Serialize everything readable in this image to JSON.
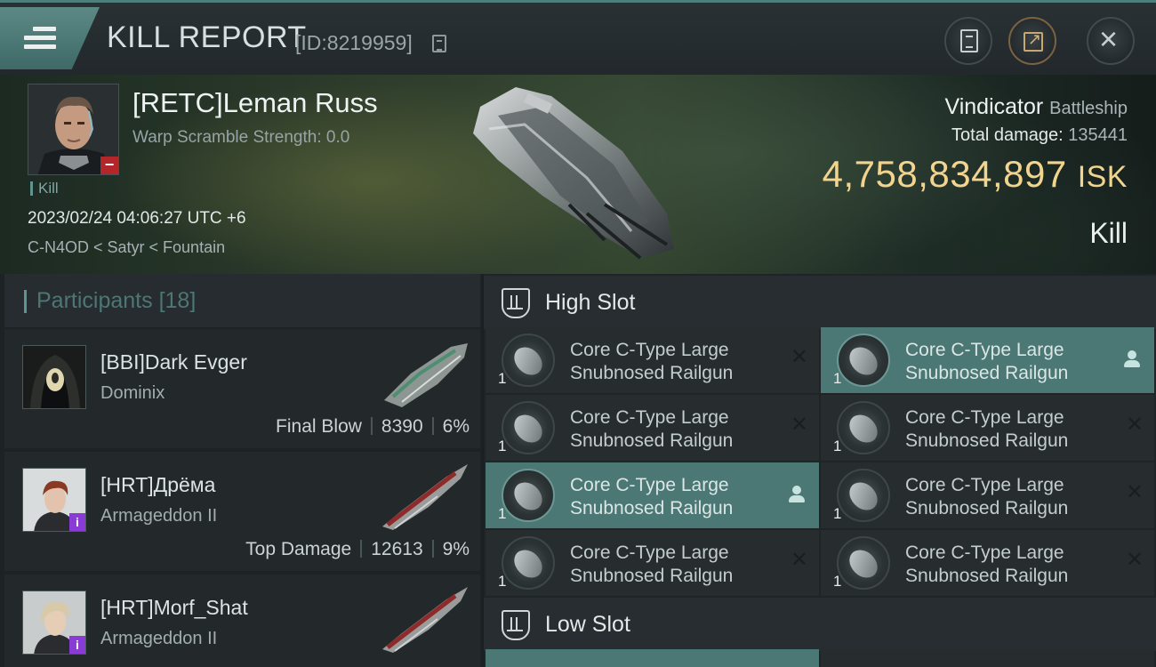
{
  "header": {
    "title": "KILL REPORT",
    "report_id": "[ID:8219959]"
  },
  "victim": {
    "name": "[RETC]Leman Russ",
    "warp_scramble": "Warp Scramble Strength: 0.0",
    "kill_tag": "Kill",
    "datetime": "2023/02/24 04:06:27 UTC +6",
    "location": "C-N4OD < Satyr < Fountain",
    "ship": "Vindicator",
    "ship_class": "Battleship",
    "total_damage_label": "Total damage:",
    "total_damage": "135441",
    "isk_value": "4,758,834,897",
    "isk_unit": "ISK",
    "kind": "Kill"
  },
  "participants": {
    "title": "Participants",
    "count": "[18]",
    "items": [
      {
        "name": "[BBI]Dark Evger",
        "ship": "Dominix",
        "role": "Final Blow",
        "damage": "8390",
        "percent": "6%"
      },
      {
        "name": "[HRT]Дрёма",
        "ship": "Armageddon II",
        "role": "Top Damage",
        "damage": "12613",
        "percent": "9%"
      },
      {
        "name": "[HRT]Morf_Shat",
        "ship": "Armageddon II",
        "role": "",
        "damage": "",
        "percent": ""
      }
    ]
  },
  "slots": {
    "high_title": "High Slot",
    "low_title": "Low Slot",
    "high_modules": [
      {
        "line1": "Core C-Type Large",
        "line2": "Snubnosed Railgun",
        "qty": "1",
        "state": "destroyed"
      },
      {
        "line1": "Core C-Type Large",
        "line2": "Snubnosed Railgun",
        "qty": "1",
        "state": "dropped"
      },
      {
        "line1": "Core C-Type Large",
        "line2": "Snubnosed Railgun",
        "qty": "1",
        "state": "destroyed"
      },
      {
        "line1": "Core C-Type Large",
        "line2": "Snubnosed Railgun",
        "qty": "1",
        "state": "destroyed"
      },
      {
        "line1": "Core C-Type Large",
        "line2": "Snubnosed Railgun",
        "qty": "1",
        "state": "dropped"
      },
      {
        "line1": "Core C-Type Large",
        "line2": "Snubnosed Railgun",
        "qty": "1",
        "state": "destroyed"
      },
      {
        "line1": "Core C-Type Large",
        "line2": "Snubnosed Railgun",
        "qty": "1",
        "state": "destroyed"
      },
      {
        "line1": "Core C-Type Large",
        "line2": "Snubnosed Railgun",
        "qty": "1",
        "state": "destroyed"
      }
    ]
  },
  "colors": {
    "accent_teal": "#4b7774",
    "isk_gold": "#f2d48e",
    "danger_red": "#b3262a",
    "corp_purple": "#8a3bd6"
  },
  "icons": {
    "menu": "hamburger-icon",
    "copy": "copy-icon",
    "clipboard": "clipboard-icon",
    "share": "share-icon",
    "close": "close-icon",
    "slot": "turret-slot-icon",
    "destroyed": "x-icon",
    "dropped": "pilot-icon"
  }
}
